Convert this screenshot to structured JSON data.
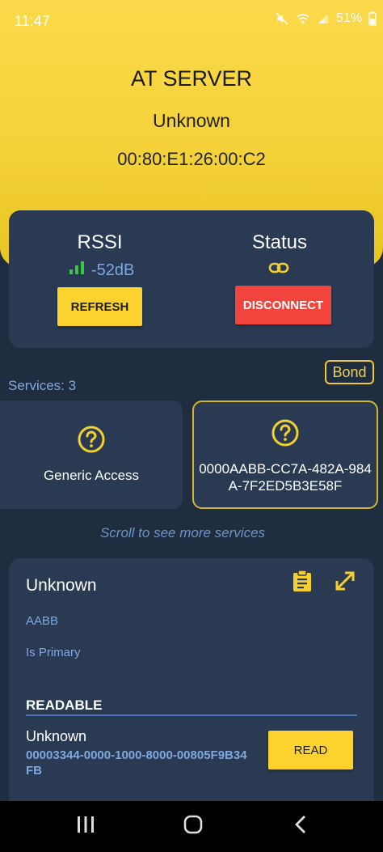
{
  "status_bar": {
    "time": "11:47",
    "battery": "51%",
    "icons": [
      "mute-icon",
      "wifi-icon",
      "signal-icon",
      "battery-icon"
    ]
  },
  "device": {
    "name": "AT SERVER",
    "state": "Unknown",
    "mac": "00:80:E1:26:00:C2"
  },
  "info_card": {
    "rssi_title": "RSSI",
    "rssi_value": "-52dB",
    "status_title": "Status",
    "refresh_label": "REFRESH",
    "disconnect_label": "DISCONNECT"
  },
  "services": {
    "count_label": "Services: 3",
    "bond_label": "Bond",
    "items": [
      {
        "name": "Generic Access"
      },
      {
        "name": "0000AABB-CC7A-482A-984A-7F2ED5B3E58F"
      }
    ],
    "scroll_hint": "Scroll to see more services"
  },
  "detail": {
    "title": "Unknown",
    "uuid": "AABB",
    "primary": "Is Primary",
    "section": "READABLE",
    "characteristic": {
      "name": "Unknown",
      "uuid": "00003344-0000-1000-8000-00805F9B34FB",
      "read_label": "READ"
    }
  },
  "colors": {
    "header_yellow": "#f5d23a",
    "background": "#1f2d40",
    "card": "#2a3a53",
    "accent_blue": "#7fa8e0",
    "button_yellow": "#fcd22e",
    "danger_red": "#f0443d"
  }
}
